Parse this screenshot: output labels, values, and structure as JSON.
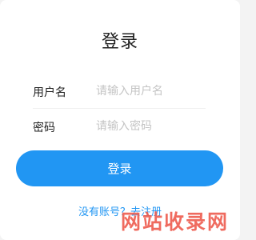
{
  "header": {
    "title": "登录"
  },
  "form": {
    "username": {
      "label": "用户名",
      "placeholder": "请输入用户名",
      "value": ""
    },
    "password": {
      "label": "密码",
      "placeholder": "请输入密码",
      "value": ""
    },
    "login_label": "登录"
  },
  "footer": {
    "register_text": "没有账号？去注册"
  },
  "watermark": {
    "text": "网站收录网"
  },
  "colors": {
    "accent": "#2196f3",
    "background": "#ffffff",
    "watermark": "#eb4132"
  }
}
